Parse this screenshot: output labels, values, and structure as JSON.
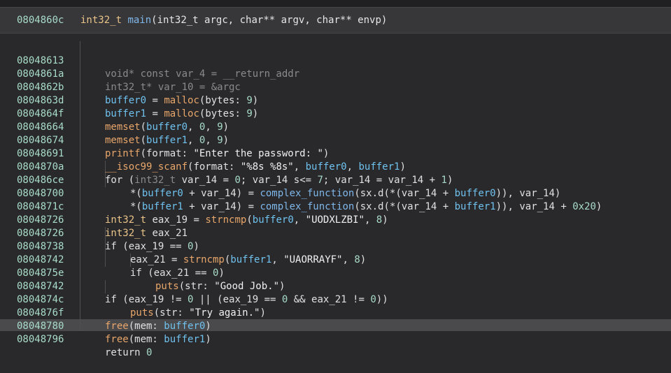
{
  "header": {
    "address": "0804860c",
    "return_type": "int32_t",
    "function_name": "main",
    "signature": "(int32_t argc, char** argv, char** envp)"
  },
  "lines": [
    {
      "address": "08048613",
      "code": "void* const var_4 = __return_addr"
    },
    {
      "address": "0804861a",
      "code": "int32_t* var_10 = &argc"
    },
    {
      "address": "0804862b",
      "code": "buffer0 = malloc(bytes: 9)"
    },
    {
      "address": "0804863d",
      "code": "buffer1 = malloc(bytes: 9)"
    },
    {
      "address": "0804864f",
      "code": "memset(buffer0, 0, 9)"
    },
    {
      "address": "08048664",
      "code": "memset(buffer1, 0, 9)"
    },
    {
      "address": "08048674",
      "code": "printf(format: \"Enter the password: \")"
    },
    {
      "address": "08048691",
      "code": "__isoc99_scanf(format: \"%8s %8s\", buffer0, buffer1)"
    },
    {
      "address": "0804870a",
      "code": "for (int32_t var_14 = 0; var_14 s<= 7; var_14 = var_14 + 1)"
    },
    {
      "address": "080486ce",
      "code": "*(buffer0 + var_14) = complex_function(sx.d(*(var_14 + buffer0)), var_14)"
    },
    {
      "address": "08048700",
      "code": "*(buffer1 + var_14) = complex_function(sx.d(*(var_14 + buffer1)), var_14 + 0x20)"
    },
    {
      "address": "0804871c",
      "code": "int32_t eax_19 = strncmp(buffer0, \"UODXLZBI\", 8)"
    },
    {
      "address": "08048726",
      "code": "int32_t eax_21"
    },
    {
      "address": "08048726",
      "code": "if (eax_19 == 0)"
    },
    {
      "address": "08048738",
      "code": "eax_21 = strncmp(buffer1, \"UAORRAYF\", 8)"
    },
    {
      "address": "08048742",
      "code": "if (eax_21 == 0)"
    },
    {
      "address": "0804875e",
      "code": "puts(str: \"Good Job.\")"
    },
    {
      "address": "08048742",
      "code": "if (eax_19 != 0 || (eax_19 == 0 && eax_21 != 0))"
    },
    {
      "address": "0804874c",
      "code": "puts(str: \"Try again.\")"
    },
    {
      "address": "0804876f",
      "code": "free(mem: buffer0)"
    },
    {
      "address": "08048780",
      "code": "free(mem: buffer1)"
    },
    {
      "address": "08048796",
      "code": "return 0"
    }
  ]
}
